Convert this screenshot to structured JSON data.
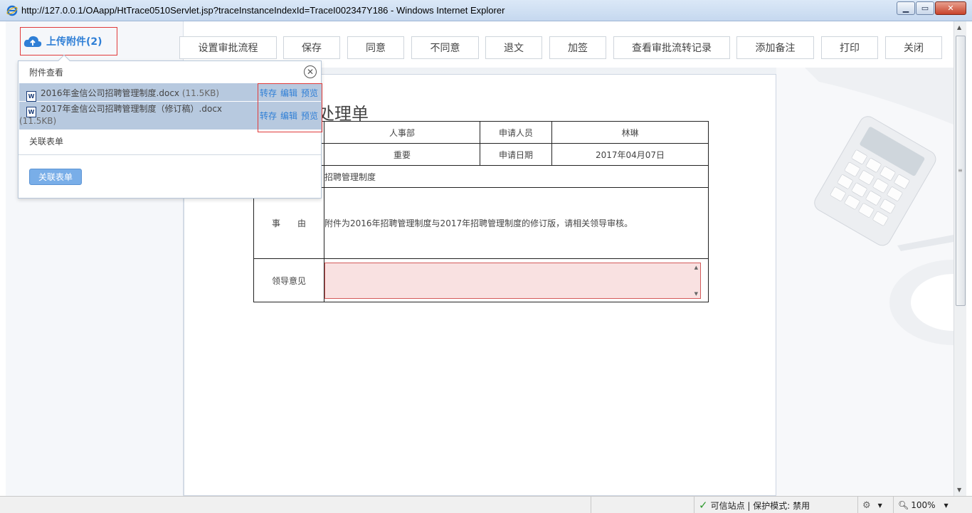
{
  "window": {
    "title": "http://127.0.0.1/OAapp/HtTrace0510Servlet.jsp?traceInstanceIndexId=TraceI002347Y186 - Windows Internet Explorer"
  },
  "upload": {
    "label": "上传附件(2)"
  },
  "toolbar": {
    "buttons": [
      "设置审批流程",
      "保存",
      "同意",
      "不同意",
      "退文",
      "加签",
      "查看审批流转记录",
      "添加备注",
      "打印",
      "关闭"
    ]
  },
  "attachments": {
    "header": "附件查看",
    "files": [
      {
        "name": "2016年金信公司招聘管理制度.docx",
        "size": "(11.5KB)"
      },
      {
        "name": "2017年金信公司招聘管理制度（修订稿）.docx",
        "size": "(11.5KB)"
      }
    ],
    "actions": [
      "转存",
      "编辑",
      "预览"
    ],
    "related_label": "关联表单",
    "related_button": "关联表单"
  },
  "form": {
    "title": "文件处理单",
    "department": "人事部",
    "applicant_label": "申请人员",
    "applicant": "林琳",
    "priority": "重要",
    "date_label": "申请日期",
    "date": "2017年04月07日",
    "subject_partial": "招聘管理制度",
    "reason_label": "事　　由",
    "reason": "附件为2016年招聘管理制度与2017年招聘管理制度的修订版，请相关领导审核。",
    "opinion_label": "领导意见"
  },
  "statusbar": {
    "trust": "可信站点 | 保护模式: 禁用",
    "zoom": "100%"
  }
}
